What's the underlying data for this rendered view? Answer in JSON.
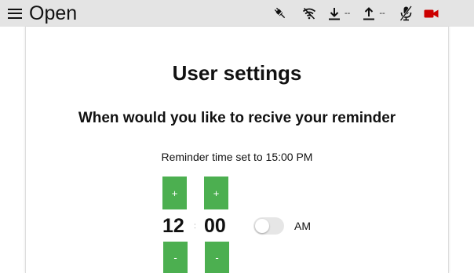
{
  "topbar": {
    "menu_label": "Open",
    "icons": [
      {
        "name": "plug-disconnected-icon"
      },
      {
        "name": "wifi-off-icon"
      },
      {
        "name": "download-icon",
        "value": "--"
      },
      {
        "name": "upload-icon",
        "value": "--"
      },
      {
        "name": "mic-off-icon"
      },
      {
        "name": "camera-icon",
        "color": "#cc0000"
      }
    ]
  },
  "page": {
    "title": "User settings",
    "question": "When would you like to recive your reminder",
    "reminder_text": "Reminder time set to 15:00 PM"
  },
  "time_picker": {
    "hours": "12",
    "minutes": "00",
    "separator": ":",
    "increment_label": "+",
    "decrement_label": "-",
    "period_label": "AM",
    "period_toggle_on": false
  },
  "colors": {
    "accent": "#4caf50",
    "topbar_bg": "#e4e4e4",
    "camera_red": "#cc0000"
  }
}
